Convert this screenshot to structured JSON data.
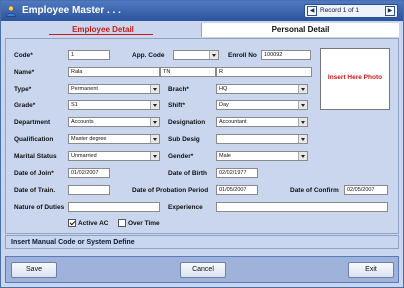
{
  "window": {
    "title": "Employee Master . . .",
    "record_text": "Record 1 of 1"
  },
  "tabs": {
    "active": "Employee Detail",
    "other": "Personal Detail"
  },
  "form": {
    "code_label": "Code*",
    "code_value": "1",
    "app_code_label": "App. Code",
    "app_code_value": "",
    "enroll_label": "Enroll No",
    "enroll_value": "100092",
    "name_label": "Name*",
    "name_first": "Rala",
    "name_middle": "TN",
    "name_last": "R",
    "type_label": "Type*",
    "type_value": "Permanent",
    "brach_label": "Brach*",
    "brach_value": "HQ",
    "grade_label": "Grade*",
    "grade_value": "S1",
    "shift_label": "Shift*",
    "shift_value": "Day",
    "department_label": "Department",
    "department_value": "Accounts",
    "designation_label": "Designation",
    "designation_value": "Accountant",
    "qualification_label": "Qualification",
    "qualification_value": "Master degree",
    "subdesig_label": "Sub Desig",
    "subdesig_value": "",
    "marital_label": "Marital Status",
    "marital_value": "Unmarried",
    "gender_label": "Gender*",
    "gender_value": "Male",
    "doj_label": "Date of Join*",
    "doj_value": "01/02/2007",
    "dob_label": "Date of Birth",
    "dob_value": "02/02/1977",
    "dot_label": "Date of Train.",
    "dot_value": "",
    "dop_label": "Date of Probation Period",
    "dop_value": "01/05/2007",
    "doc_label": "Date of Confirm",
    "doc_value": "02/05/2007",
    "duties_label": "Nature of Duties",
    "duties_value": "",
    "experience_label": "Experience",
    "experience_value": "",
    "active_label": "Active AC",
    "active_checked": true,
    "overtime_label": "Over Time",
    "overtime_checked": false,
    "photo_placeholder": "Insert Here Photo"
  },
  "hint": "Insert Manual Code or System Define",
  "buttons": {
    "save": "Save",
    "cancel": "Cancel",
    "exit": "Exit"
  }
}
